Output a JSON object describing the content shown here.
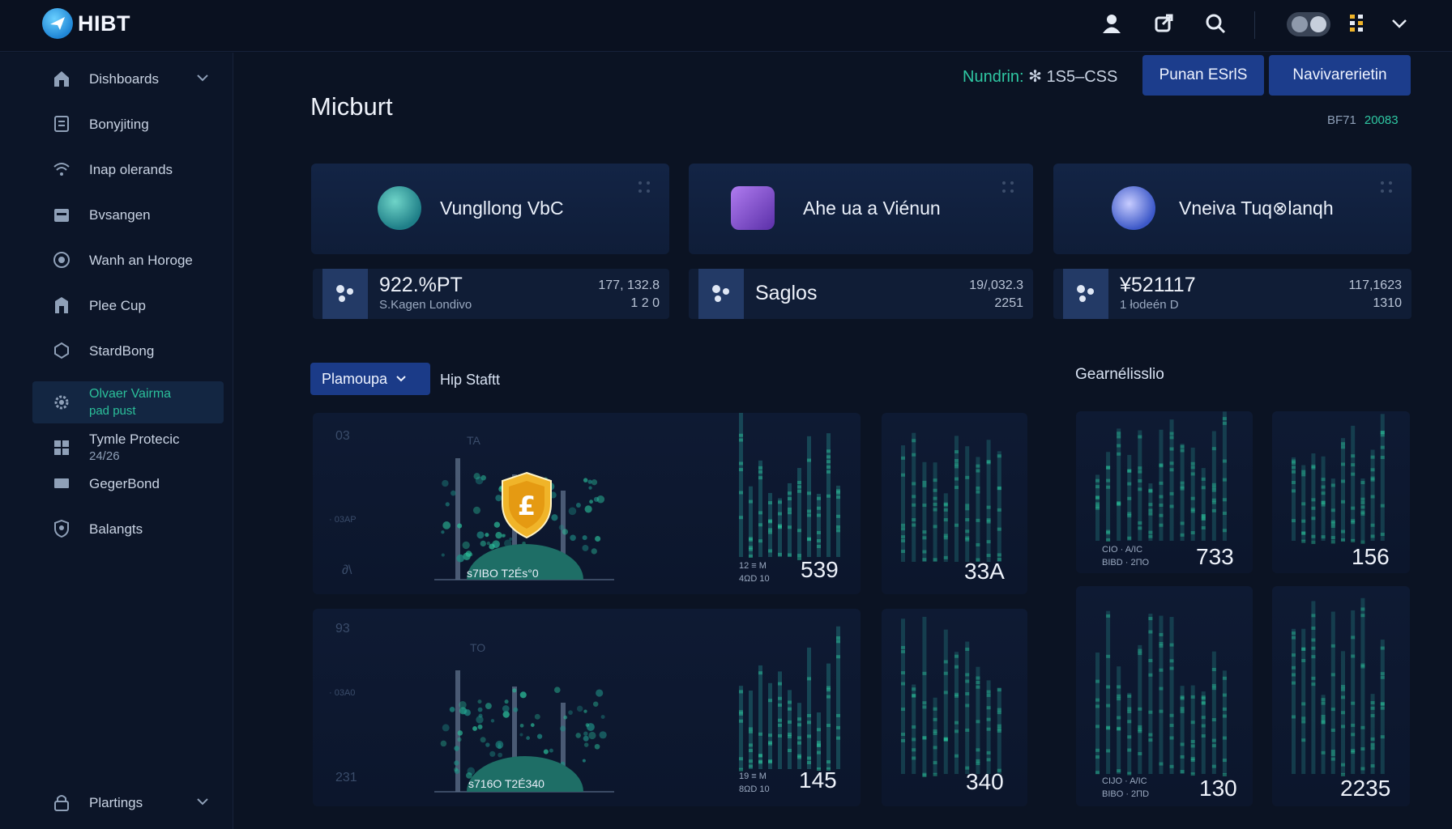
{
  "brand": {
    "name": "HIBT"
  },
  "topbar": {
    "icons": [
      "user-icon",
      "share-icon",
      "search-icon",
      "theme-toggle",
      "grid-icon",
      "chevron-down-icon"
    ]
  },
  "sidebar": {
    "items": [
      {
        "label": "Dishboards",
        "icon": "home-icon",
        "has_chevron": true
      },
      {
        "label": "Bonyjiting",
        "icon": "document-icon"
      },
      {
        "label": "Inap olerands",
        "icon": "wifi-icon"
      },
      {
        "label": "Bvsangen",
        "icon": "calendar-icon"
      },
      {
        "label": "Wanh an Horoge",
        "icon": "target-icon"
      },
      {
        "label": "Plee Cup",
        "icon": "building-icon"
      },
      {
        "label": "StardBong",
        "icon": "hexagon-icon"
      },
      {
        "label": "Olvaer Vairma",
        "sub": "pad pust",
        "icon": "gear-icon",
        "active": true
      },
      {
        "label": "Tymle Protecic",
        "sub": "24/26",
        "icon": "windows-icon"
      },
      {
        "label": "GegerBond",
        "icon": "card-icon"
      },
      {
        "label": "Balangts",
        "icon": "shield-icon"
      },
      {
        "label": "Plartings",
        "icon": "lock-icon",
        "has_chevron": true
      }
    ]
  },
  "header": {
    "title": "Micburt",
    "status_label": "Nundrin:",
    "status_value": "✻ 1S5–CSS",
    "button_primary": "Punan ESrlS",
    "button_secondary": "Navivarerietin",
    "version_label": "BF71",
    "version_value": "20083"
  },
  "cards": [
    {
      "name": "Vungllong VbC",
      "avatar_color": "#3aa3a0"
    },
    {
      "name": "Ahe ua a Viénun",
      "avatar_color": "#8a5cd6"
    },
    {
      "name": "Vneiva Tuq⊗lanqh",
      "avatar_color": "#6f7fe0"
    }
  ],
  "stats": [
    {
      "big": "922.%PT",
      "small": "S.Kagen Londivo",
      "r1": "177, 132.8",
      "r2": "1 2 0"
    },
    {
      "big": "Saglos",
      "small": "",
      "r1": "19/,032.3",
      "r2": "2251"
    },
    {
      "big": "¥521117",
      "small": "1 łodeén D",
      "r1": "117,1623",
      "r2": "1310"
    }
  ],
  "filters": {
    "select_value": "Plamoupa",
    "filter_label": "Hip Staftt",
    "section_label": "Gearnélisslio"
  },
  "panels": {
    "main": [
      {
        "axis_top": "03",
        "axis_mid": "TA",
        "axis_side": "· 03AP",
        "axis_bottom": "∂\\",
        "dome_label": "s7IBO T2És°0",
        "tiny_top": "12 ≡ M",
        "tiny_bot": "4ΩD 10",
        "value": "539",
        "side_value": "33A",
        "has_badge": true
      },
      {
        "axis_top": "93",
        "axis_mid": "TO",
        "axis_side": "· 03A0",
        "axis_bottom": "231",
        "dome_label": "s716O T2É340",
        "tiny_top": "19 ≡ M",
        "tiny_bot": "8ΩD 10",
        "value": "145",
        "side_value": "340",
        "has_badge": false
      }
    ],
    "right": [
      {
        "tiny_top": "CIO · A/IC",
        "tiny_bot": "BIBD · 2ΠO",
        "value": "733",
        "side_value": "156"
      },
      {
        "tiny_top": "CIJO · A/IC",
        "tiny_bot": "BIBO · 2ΠD",
        "value": "130",
        "side_value": "2235"
      }
    ]
  },
  "colors": {
    "accent_teal": "#2fc8a3",
    "button_blue": "#1c3d8c",
    "badge_gold": "#f0b429",
    "background": "#0b1323"
  }
}
